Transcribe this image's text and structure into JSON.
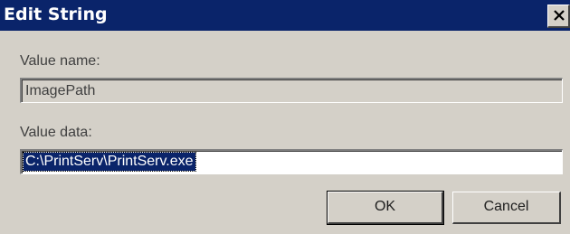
{
  "dialog": {
    "title": "Edit String",
    "close_icon": "close-icon"
  },
  "value_name": {
    "label": "Value name:",
    "value": "ImagePath"
  },
  "value_data": {
    "label": "Value data:",
    "value": "C:\\PrintServ\\PrintServ.exe"
  },
  "buttons": {
    "ok": "OK",
    "cancel": "Cancel"
  },
  "colors": {
    "titlebar": "#0a246a",
    "dialog_bg": "#d4d0c8",
    "selection": "#0a246a"
  }
}
